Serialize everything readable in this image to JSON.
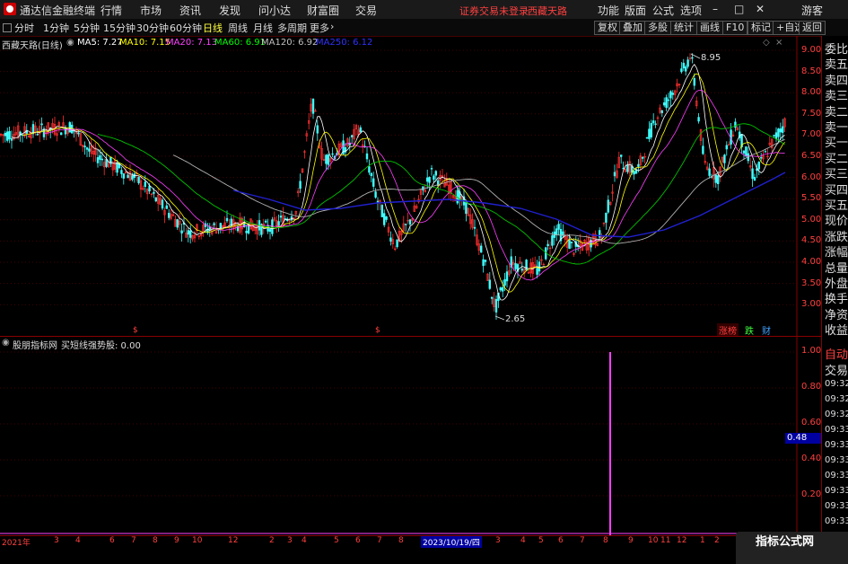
{
  "app": {
    "title": "通达信金融终端",
    "guest": "游客"
  },
  "menu": [
    "行情",
    "市场",
    "资讯",
    "发现",
    "问小达",
    "财富圈",
    "交易"
  ],
  "status": {
    "login": "证券交易未登录",
    "stock": "西藏天路"
  },
  "right_menu": [
    "功能",
    "版面",
    "公式",
    "选项"
  ],
  "window_buttons": [
    "–",
    "□",
    "✕"
  ],
  "periods": [
    "分时",
    "1分钟",
    "5分钟",
    "15分钟",
    "30分钟",
    "60分钟",
    "日线",
    "周线",
    "月线",
    "多周期",
    "更多"
  ],
  "active_period": "日线",
  "toolbar_buttons": [
    "复权",
    "叠加",
    "多股",
    "统计",
    "画线",
    "F10",
    "标记",
    "+自选",
    "返回"
  ],
  "main_chart": {
    "stock_label": "西藏天路(日线)",
    "ma": [
      {
        "label": "MA5: 7.27",
        "color": "#ffffff"
      },
      {
        "label": "MA10: 7.15",
        "color": "#ffff00"
      },
      {
        "label": "MA20: 7.13",
        "color": "#ff40ff"
      },
      {
        "label": "MA60: 6.91",
        "color": "#00ff00"
      },
      {
        "label": "MA120: 6.92",
        "color": "#c0c0c0"
      },
      {
        "label": "MA250: 6.12",
        "color": "#3030ff"
      }
    ],
    "high_label": "8.95",
    "low_label": "2.65",
    "yticks": [
      "9.00",
      "8.50",
      "8.00",
      "7.50",
      "7.00",
      "6.50",
      "6.00",
      "5.50",
      "5.00",
      "4.50",
      "4.00",
      "3.50",
      "3.00"
    ],
    "badges": [
      "涨榜",
      "跌",
      "财"
    ]
  },
  "sub_chart": {
    "indicator": "股朋指标网",
    "label": "买短线强势股: 0.00",
    "yticks": [
      "1.00",
      "0.80",
      "0.60",
      "0.40",
      "0.20"
    ],
    "current": "0.48"
  },
  "right_panel": {
    "items": [
      "委比",
      "卖五",
      "卖四",
      "卖三",
      "卖二",
      "卖一",
      "买一",
      "买二",
      "买三",
      "买四",
      "买五",
      "现价",
      "涨跌",
      "涨幅",
      "总量",
      "外盘",
      "换手",
      "净资",
      "收益"
    ],
    "auto": "自动",
    "trade": "交易",
    "times": [
      "09:32",
      "09:32",
      "09:32",
      "09:33",
      "09:33",
      "09:33",
      "09:33",
      "09:33",
      "09:33",
      "09:33"
    ]
  },
  "xaxis": {
    "labels": [
      "2021年",
      "3",
      "4",
      "6",
      "7",
      "8",
      "9",
      "10",
      "12",
      "2",
      "3",
      "4",
      "5",
      "6",
      "7",
      "8",
      "9",
      "10",
      "12",
      "2",
      "3",
      "4",
      "5",
      "6",
      "7",
      "8",
      "9",
      "10",
      "11",
      "12",
      "1",
      "2"
    ],
    "cursor_date": "2023/10/19/四"
  },
  "watermark": {
    "text": "指标公式网",
    "url": "www.zbgs3.com"
  }
}
